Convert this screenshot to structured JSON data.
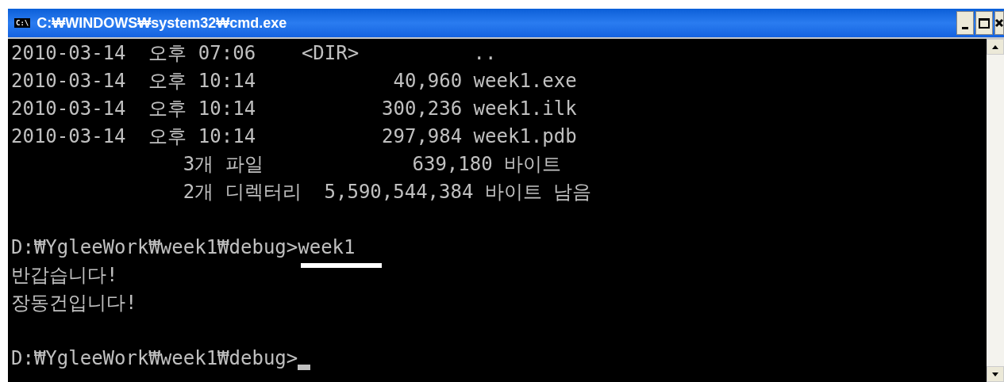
{
  "window": {
    "title": "C:₩WINDOWS₩system32₩cmd.exe",
    "icon_text": "C:\\"
  },
  "lines": [
    {
      "kind": "text",
      "text": "2010-03-14  오후 07:06    <DIR>          .."
    },
    {
      "kind": "text",
      "text": "2010-03-14  오후 10:14            40,960 week1.exe"
    },
    {
      "kind": "text",
      "text": "2010-03-14  오후 10:14           300,236 week1.ilk"
    },
    {
      "kind": "text",
      "text": "2010-03-14  오후 10:14           297,984 week1.pdb"
    },
    {
      "kind": "text",
      "text": "               3개 파일             639,180 바이트"
    },
    {
      "kind": "text",
      "text": "               2개 디렉터리  5,590,544,384 바이트 남음"
    },
    {
      "kind": "blank"
    },
    {
      "kind": "text",
      "text": "D:₩YgleeWork₩week1₩debug>week1",
      "underlined": true
    },
    {
      "kind": "text",
      "text": "반갑습니다!"
    },
    {
      "kind": "text",
      "text": "장동건입니다!"
    },
    {
      "kind": "blank"
    },
    {
      "kind": "text",
      "text": "D:₩YgleeWork₩week1₩debug>",
      "cursor": true
    }
  ]
}
